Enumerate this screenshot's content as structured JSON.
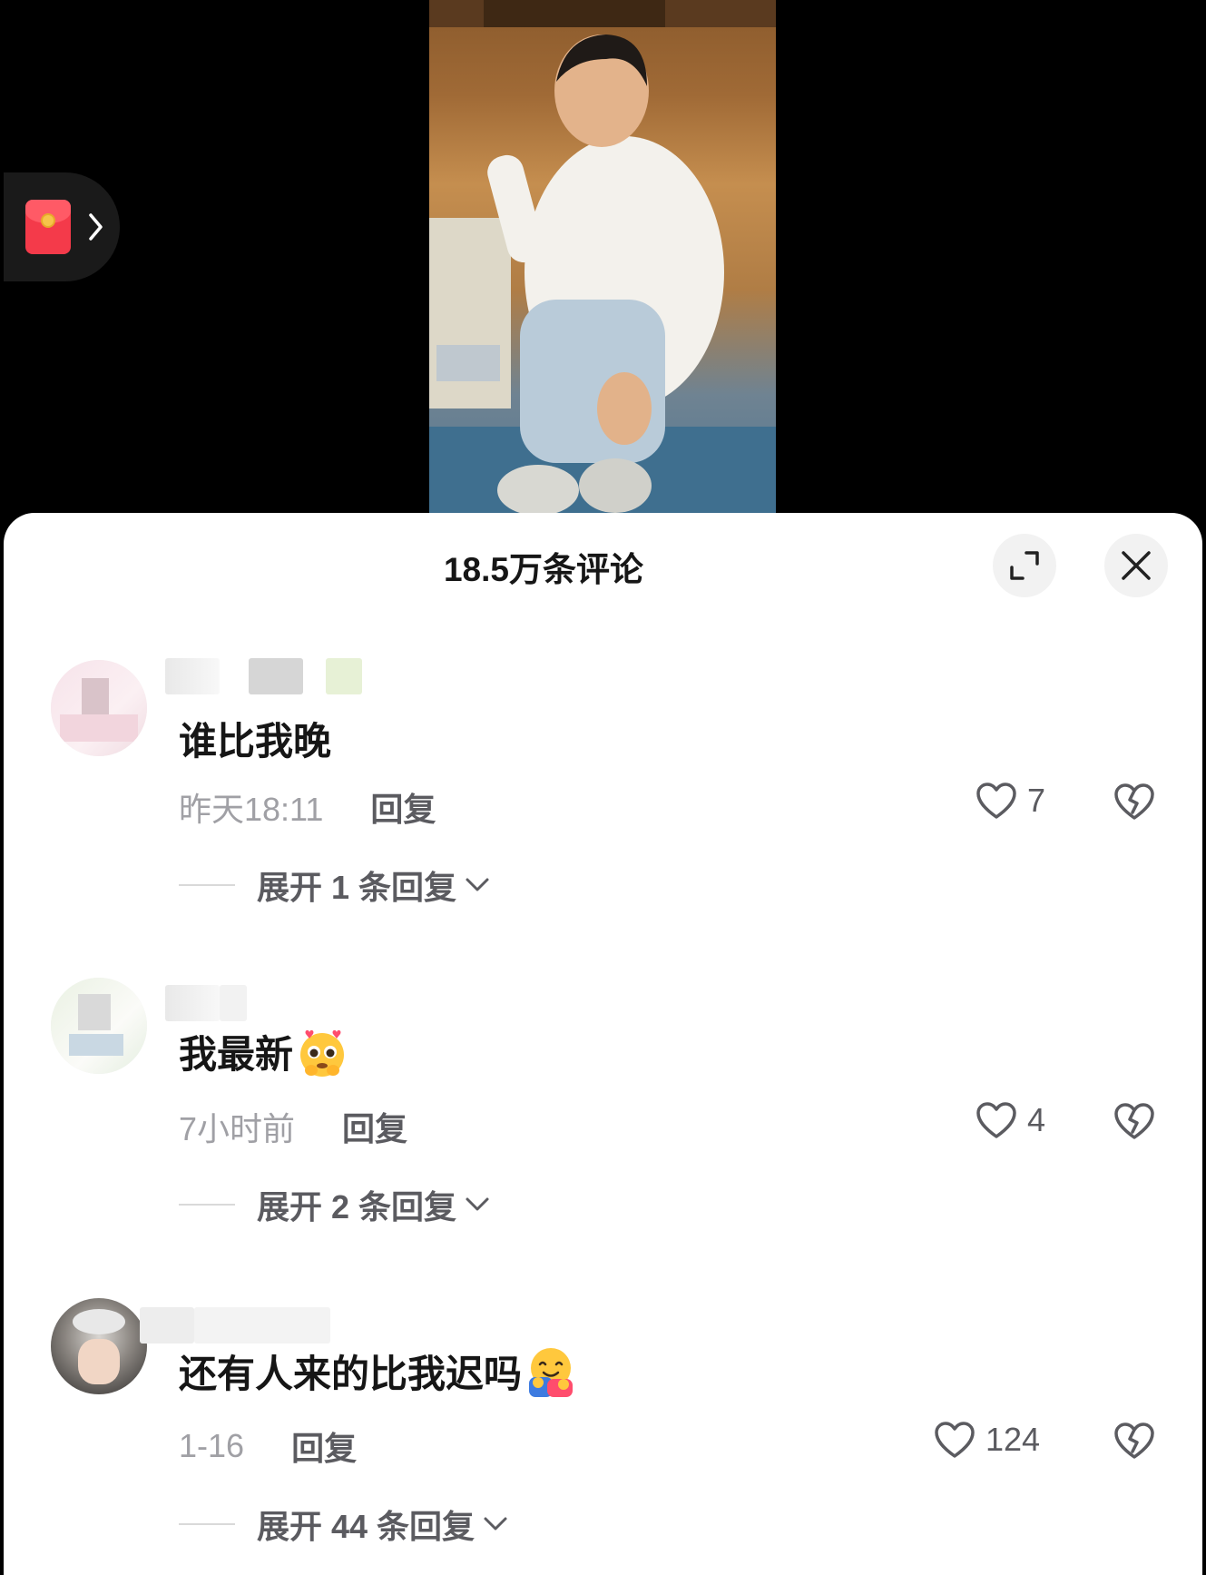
{
  "video": {
    "red_packet_icon": "red-packet-icon",
    "chevron_icon": "chevron-right-icon"
  },
  "sheet": {
    "title": "18.5万条评论",
    "expand_icon": "expand-icon",
    "close_icon": "close-icon"
  },
  "comments": [
    {
      "text": "谁比我晚",
      "time": "昨天18:11",
      "reply_label": "回复",
      "likes": "7",
      "expand_label": "展开 1 条回复",
      "emoji": ""
    },
    {
      "text": "我最新",
      "time": "7小时前",
      "reply_label": "回复",
      "likes": "4",
      "expand_label": "展开 2 条回复",
      "emoji": "pleading-face-emoji"
    },
    {
      "text": "还有人来的比我迟吗",
      "time": "1-16",
      "reply_label": "回复",
      "likes": "124",
      "expand_label": "展开 44 条回复",
      "emoji": "hugging-face-emoji"
    }
  ],
  "colors": {
    "accent_red": "#f43a4a",
    "text_primary": "#161616",
    "text_secondary": "#a0a0a5",
    "text_action": "#5b5b60"
  }
}
